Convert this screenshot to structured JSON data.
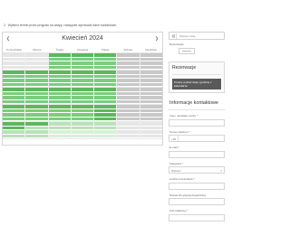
{
  "notice": {
    "number": "2.",
    "text": "Wybierz termin przez program na wstęp, następnie wprowadź dane kontaktowe."
  },
  "calendar": {
    "title": "Kwiecień 2024",
    "prev_icon": "chevron-left-icon",
    "next_icon": "chevron-right-icon",
    "weekdays": [
      "Poniedziałek",
      "Wtorek",
      "Środa",
      "Czwartek",
      "Piątek",
      "Sobota",
      "Niedziela"
    ],
    "colors": {
      "green_dark": "#5cb85c",
      "green_mid": "#7ccc7c",
      "green_light": "#b8e2b8",
      "green_pale": "#d8efd8",
      "grey": "#c8c8c8",
      "grey_light": "#e6e6e6"
    }
  },
  "sidebar": {
    "search_placeholder": "Wybierz datę",
    "search_icon": "calendar-icon",
    "participants_label": "Rezerwacje",
    "reservation": {
      "title": "Rezerwacje",
      "item": "Proszę wybrać datę i godzinę z kalendarza"
    },
    "contact": {
      "title": "Informacje kontaktowe",
      "fields": [
        {
          "label": "Imię i nazwisko osoby *",
          "value": ""
        },
        {
          "label": "Numer telefonu *",
          "value": "",
          "cc": "+48"
        },
        {
          "label": "E-mail *",
          "value": ""
        },
        {
          "label": "Kategoria *",
          "value": "Wybierz",
          "select": true
        },
        {
          "label": "Liczba uczestników *",
          "value": ""
        },
        {
          "label": "Nazwa firmy/grupy/organizacji",
          "value": ""
        },
        {
          "label": "Kod rabatowy *",
          "value": ""
        }
      ]
    }
  }
}
